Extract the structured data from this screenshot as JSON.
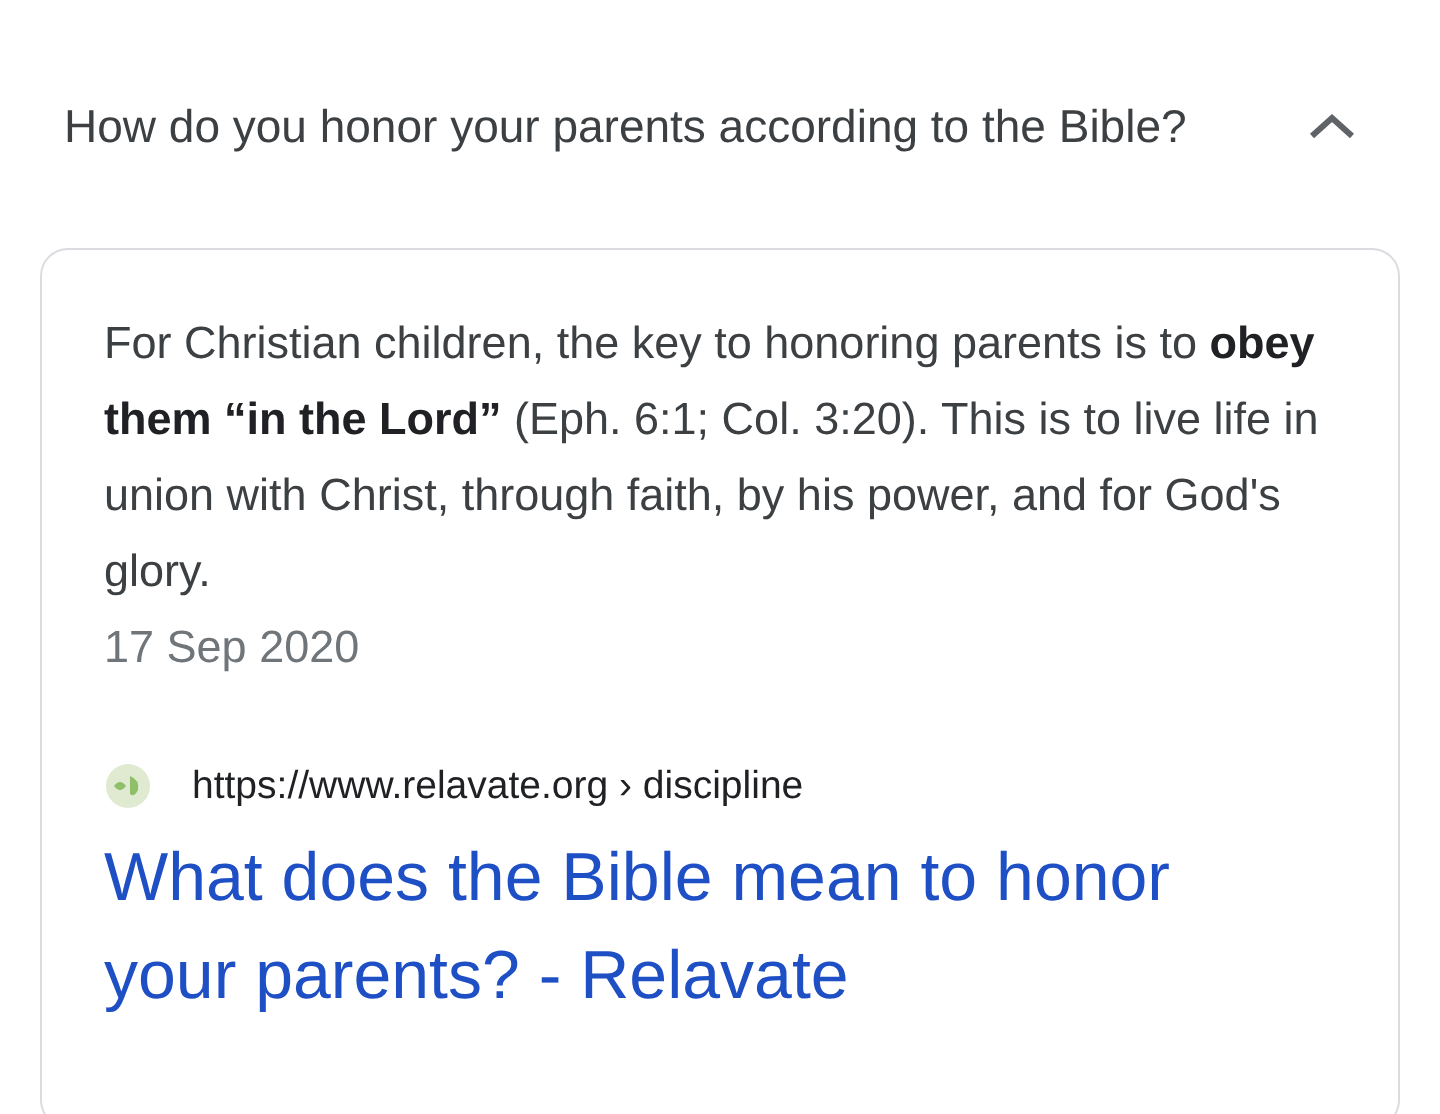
{
  "question": {
    "text": "How do you honor your parents according to the Bible?",
    "expanded": true
  },
  "answer": {
    "snippet": "For Christian children, the key to honoring parents is to **obey them “in the Lord”** (Eph. 6:1; Col. 3:20). This is to live life in union with Christ, through faith, by his power, and for God's glory.",
    "date": "17 Sep 2020",
    "url": "https://www.relavate.org › discipline",
    "title": "What does the Bible mean to honor your parents? - Relavate"
  }
}
